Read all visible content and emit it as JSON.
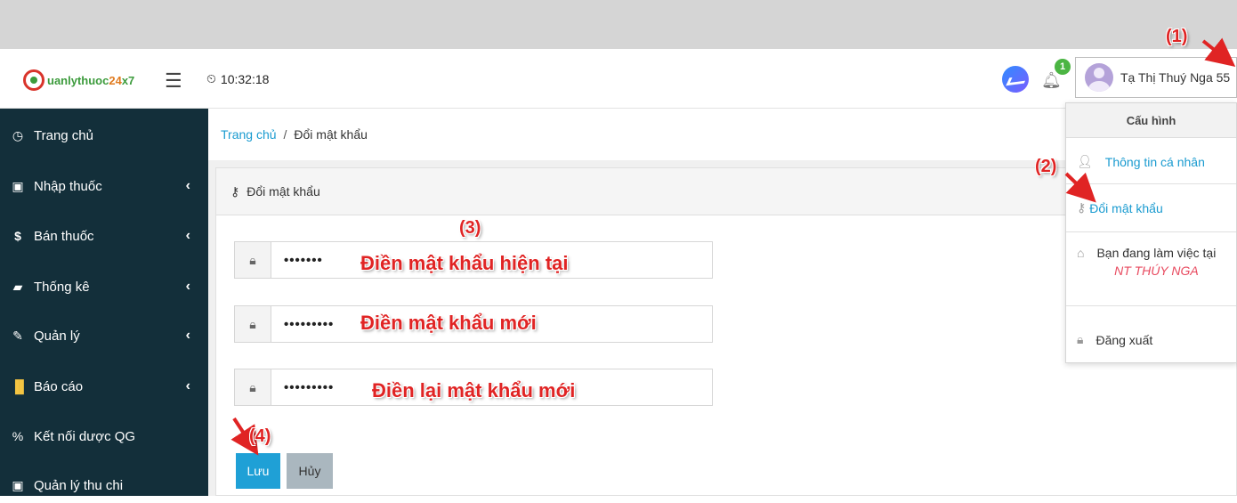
{
  "header": {
    "logo": {
      "part1": "Q",
      "part2": "uanlythuoc",
      "part3": "24",
      "part4": "x",
      "part5": "7"
    },
    "menu_icon": "hamburger-icon",
    "clock": "10:32:18",
    "notification_count": "1",
    "user_name": "Tạ Thị Thuý Nga 55"
  },
  "sidebar": {
    "items": [
      {
        "label": "Trang chủ",
        "icon": "dashboard-icon"
      },
      {
        "label": "Nhập thuốc",
        "icon": "import-icon"
      },
      {
        "label": "Bán thuốc",
        "icon": "dollar-icon"
      },
      {
        "label": "Thống kê",
        "icon": "folder-icon"
      },
      {
        "label": "Quản lý",
        "icon": "edit-icon"
      },
      {
        "label": "Báo cáo",
        "icon": "bar-chart-icon"
      },
      {
        "label": "Kết nối dược QG",
        "icon": "link-icon"
      },
      {
        "label": "Quản lý thu chi",
        "icon": "money-icon"
      }
    ]
  },
  "breadcrumb": {
    "home": "Trang chủ",
    "separator": "/",
    "current": "Đổi mật khẩu"
  },
  "form": {
    "title": "Đổi mật khẩu",
    "current_password": "•••••••",
    "new_password": "•••••••••",
    "confirm_password": "•••••••••",
    "save_label": "Lưu",
    "cancel_label": "Hủy"
  },
  "dropdown": {
    "header": "Cấu hình",
    "profile": "Thông tin cá nhân",
    "change_password": "Đổi mật khẩu",
    "workplace_label": "Bạn đang làm việc tại",
    "workplace_name": "NT THÚY NGA",
    "logout": "Đăng xuất"
  },
  "annotations": {
    "step1": "(1)",
    "step2": "(2)",
    "step3": "(3)",
    "step4": "(4)",
    "current_hint": "Điền mật khẩu hiện tại",
    "new_hint": "Điền mật khẩu mới",
    "confirm_hint": "Điền lại mật khẩu mới"
  },
  "colors": {
    "sidebar_bg": "#132f3a",
    "accent": "#1fa0d6",
    "annotation": "#e02424",
    "workplace": "#e84a5f"
  }
}
